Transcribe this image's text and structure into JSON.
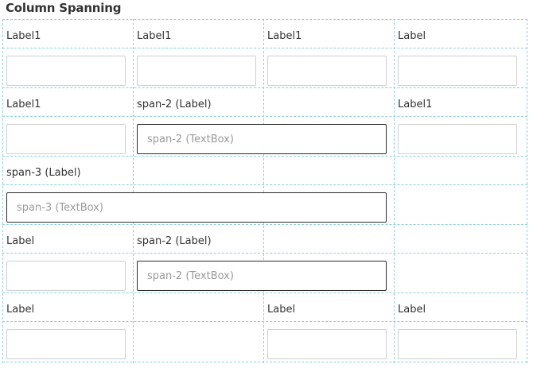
{
  "title": "Column Spanning",
  "rows": [
    {
      "labels": [
        "Label1",
        "Label1",
        "Label1",
        "Label"
      ],
      "fields": [
        "",
        "",
        "",
        ""
      ]
    },
    {
      "labels": [
        "Label1",
        "span-2 (Label)",
        "Label1"
      ],
      "fields": [
        {
          "value": "",
          "placeholder": ""
        },
        {
          "value": "",
          "placeholder": "span-2 (TextBox)"
        },
        {
          "value": "",
          "placeholder": ""
        }
      ]
    },
    {
      "labels": [
        "span-3 (Label)"
      ],
      "fields": [
        {
          "value": "",
          "placeholder": "span-3 (TextBox)"
        }
      ]
    },
    {
      "labels": [
        "Label",
        "span-2 (Label)"
      ],
      "fields": [
        {
          "value": "",
          "placeholder": ""
        },
        {
          "value": "",
          "placeholder": "span-2 (TextBox)"
        }
      ]
    },
    {
      "labels": [
        "Label",
        "Label",
        "Label"
      ],
      "fields": [
        "",
        "",
        ""
      ]
    }
  ]
}
